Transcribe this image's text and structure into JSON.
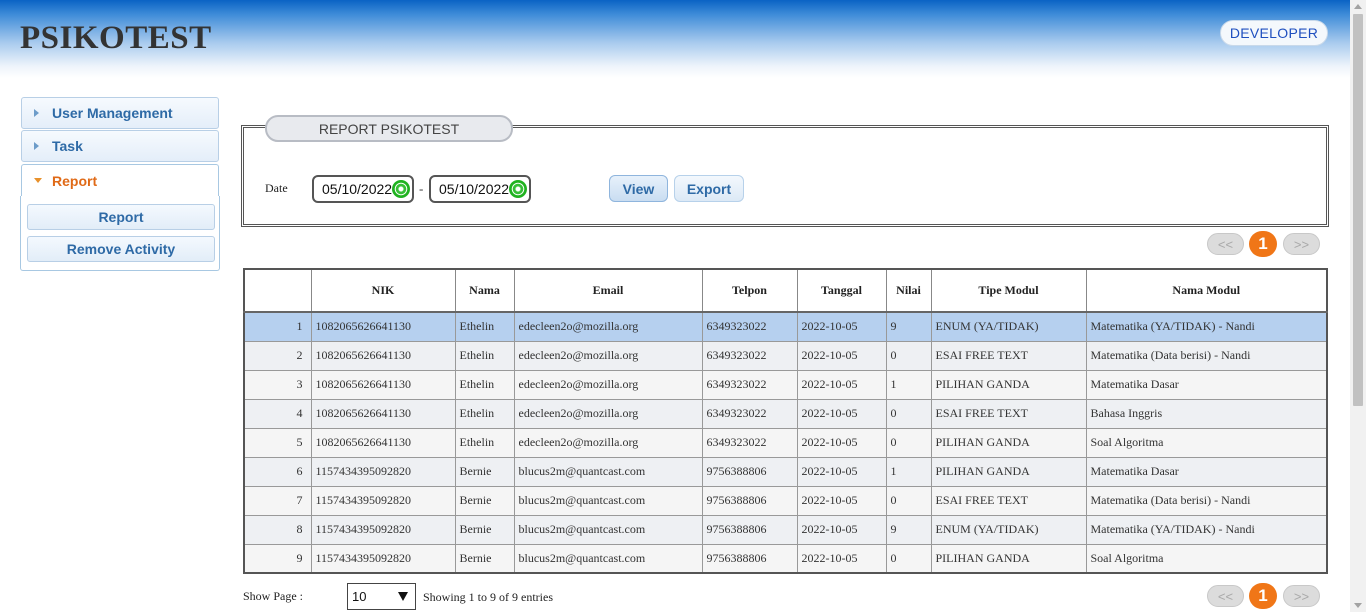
{
  "app": {
    "title": "PSIKOTEST",
    "user_role": "DEVELOPER"
  },
  "sidebar": {
    "sections": [
      {
        "label": "User Management"
      },
      {
        "label": "Task"
      },
      {
        "label": "Report"
      }
    ],
    "report_items": [
      {
        "label": "Report"
      },
      {
        "label": "Remove Activity"
      }
    ]
  },
  "report_form": {
    "legend": "REPORT PSIKOTEST",
    "date_label": "Date",
    "date_from": "05/10/2022",
    "date_separator": "-",
    "date_to": "05/10/2022",
    "view_label": "View",
    "export_label": "Export"
  },
  "pagination": {
    "prev": "<<",
    "current": "1",
    "next": ">>"
  },
  "table": {
    "headers": [
      "",
      "NIK",
      "Nama",
      "Email",
      "Telpon",
      "Tanggal",
      "Nilai",
      "Tipe Modul",
      "Nama Modul"
    ],
    "selected_row": 1,
    "rows": [
      [
        "1",
        "1082065626641130",
        "Ethelin",
        "edecleen2o@mozilla.org",
        "6349323022",
        "2022-10-05",
        "9",
        "ENUM (YA/TIDAK)",
        "Matematika (YA/TIDAK) - Nandi"
      ],
      [
        "2",
        "1082065626641130",
        "Ethelin",
        "edecleen2o@mozilla.org",
        "6349323022",
        "2022-10-05",
        "0",
        "ESAI FREE TEXT",
        "Matematika (Data berisi) - Nandi"
      ],
      [
        "3",
        "1082065626641130",
        "Ethelin",
        "edecleen2o@mozilla.org",
        "6349323022",
        "2022-10-05",
        "1",
        "PILIHAN GANDA",
        "Matematika Dasar"
      ],
      [
        "4",
        "1082065626641130",
        "Ethelin",
        "edecleen2o@mozilla.org",
        "6349323022",
        "2022-10-05",
        "0",
        "ESAI FREE TEXT",
        "Bahasa Inggris"
      ],
      [
        "5",
        "1082065626641130",
        "Ethelin",
        "edecleen2o@mozilla.org",
        "6349323022",
        "2022-10-05",
        "0",
        "PILIHAN GANDA",
        "Soal Algoritma"
      ],
      [
        "6",
        "1157434395092820",
        "Bernie",
        "blucus2m@quantcast.com",
        "9756388806",
        "2022-10-05",
        "1",
        "PILIHAN GANDA",
        "Matematika Dasar"
      ],
      [
        "7",
        "1157434395092820",
        "Bernie",
        "blucus2m@quantcast.com",
        "9756388806",
        "2022-10-05",
        "0",
        "ESAI FREE TEXT",
        "Matematika (Data berisi) - Nandi"
      ],
      [
        "8",
        "1157434395092820",
        "Bernie",
        "blucus2m@quantcast.com",
        "9756388806",
        "2022-10-05",
        "9",
        "ENUM (YA/TIDAK)",
        "Matematika (YA/TIDAK) - Nandi"
      ],
      [
        "9",
        "1157434395092820",
        "Bernie",
        "blucus2m@quantcast.com",
        "9756388806",
        "2022-10-05",
        "0",
        "PILIHAN GANDA",
        "Soal Algoritma"
      ]
    ]
  },
  "footer": {
    "show_page_label": "Show Page :",
    "page_size": "10",
    "showing_text": "Showing 1 to 9 of 9 entries"
  },
  "colors": {
    "accent": "#f07617",
    "link": "#2e6aa6",
    "selected_row": "#b6d0ef",
    "header_blue": "#0a63c4"
  }
}
